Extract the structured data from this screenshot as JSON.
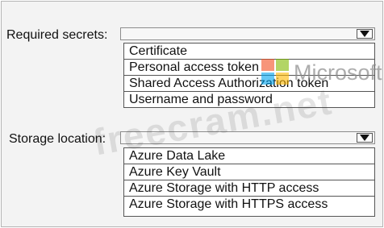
{
  "secrets": {
    "label": "Required secrets:",
    "selected_value": "",
    "options": [
      "Certificate",
      "Personal access token",
      "Shared Access Authorization token",
      "Username and password"
    ]
  },
  "storage": {
    "label": "Storage location:",
    "selected_value": "",
    "options": [
      "Azure Data Lake",
      "Azure Key Vault",
      "Azure Storage with HTTP access",
      "Azure Storage with HTTPS access"
    ]
  },
  "logo": {
    "text": "Microsoft",
    "colors": [
      "#f25022",
      "#7fba00",
      "#00a4ef",
      "#ffb900"
    ]
  },
  "watermark": {
    "text": "freecram.net"
  },
  "colors": {
    "panel_bg": "#f3f3f3",
    "border": "#555555",
    "text": "#111111"
  }
}
